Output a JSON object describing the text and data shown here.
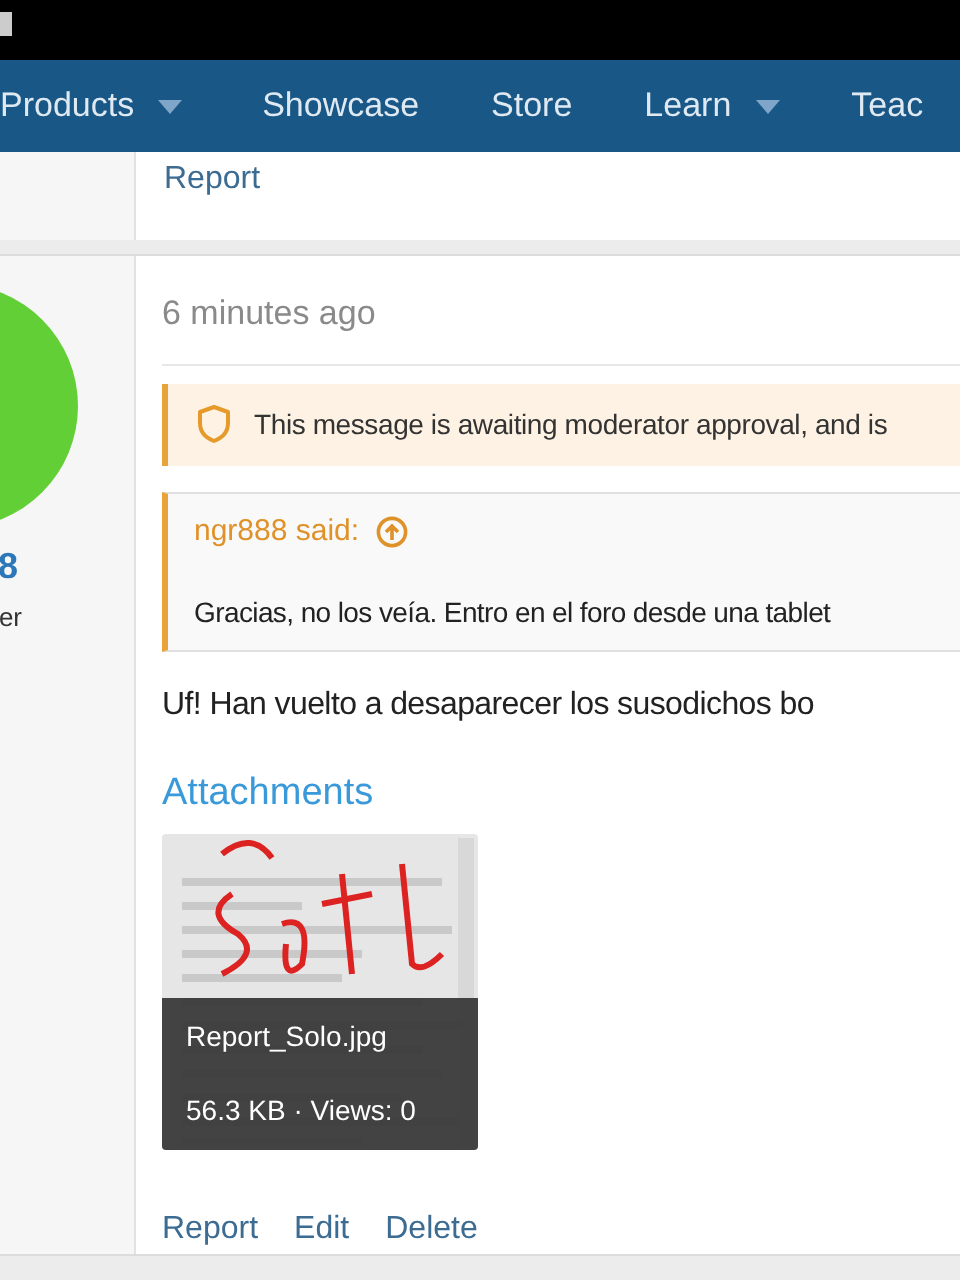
{
  "nav": {
    "items": [
      {
        "label": "Products",
        "has_menu": true
      },
      {
        "label": "Showcase",
        "has_menu": false
      },
      {
        "label": "Store",
        "has_menu": false
      },
      {
        "label": "Learn",
        "has_menu": true
      },
      {
        "label": "Teac",
        "has_menu": false
      }
    ]
  },
  "previous_post": {
    "actions": [
      "Report"
    ]
  },
  "post": {
    "author_fragment": "8",
    "role_fragment": "er",
    "time": "6 minutes ago",
    "notice": "This message is awaiting moderator approval, and is",
    "quote": {
      "author": "ngr888 said:",
      "text": "Gracias, no los veía. Entro en el foro desde una tablet"
    },
    "body": "Uf! Han vuelto a desaparecer los susodichos bo",
    "attachments_title": "Attachments",
    "attachments": [
      {
        "kind": "picture",
        "filename": "Report_Solo.jpg",
        "meta": "56.3 KB · Views: 0"
      }
    ],
    "actions": [
      "Report",
      "Edit",
      "Delete"
    ]
  }
}
